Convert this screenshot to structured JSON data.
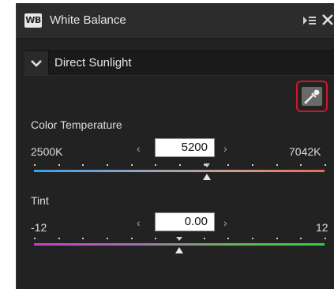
{
  "panel": {
    "badge": "WB",
    "title": "White Balance"
  },
  "preset": {
    "selected": "Direct Sunlight"
  },
  "temperature": {
    "label": "Color Temperature",
    "min": "2500K",
    "max": "7042K",
    "value": "5200",
    "level": 0.594
  },
  "tint": {
    "label": "Tint",
    "min": "-12",
    "max": "12",
    "value": "0.00",
    "level": 0.5
  },
  "icons": {
    "menu": "panel-menu-icon",
    "close": "close-icon",
    "dropdown": "chevron-down-icon",
    "picker": "eyedropper-icon"
  },
  "colors": {
    "highlight": "#d4142a",
    "panel_bg": "#222222"
  }
}
